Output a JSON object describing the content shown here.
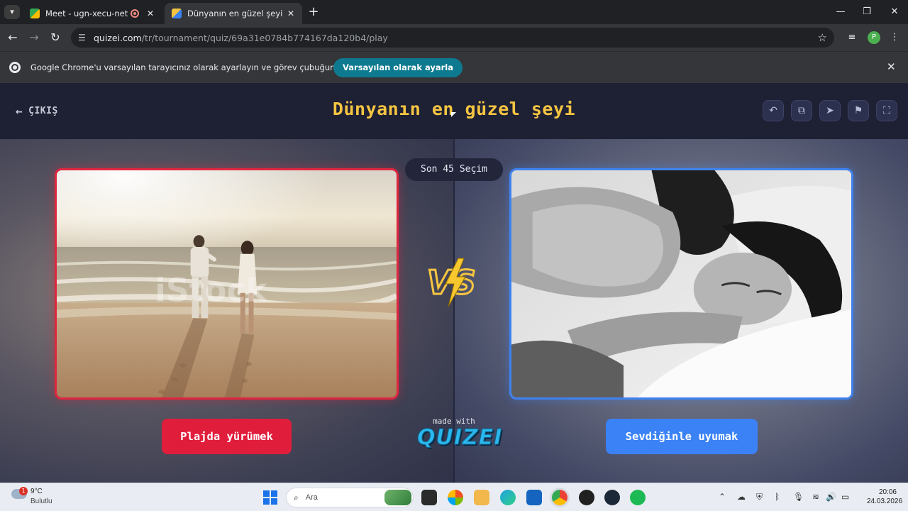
{
  "browser": {
    "tabs": [
      {
        "title": "Meet - ugn-xecu-net",
        "active": false
      },
      {
        "title": "Dünyanın en güzel şeyi - Tier Li",
        "active": true
      }
    ],
    "url_host": "quizei.com",
    "url_path": "/tr/tournament/quiz/69a31e0784b774167da120b4/play",
    "profile_initial": "P",
    "infobar": {
      "message": "Google Chrome'u varsayılan tarayıcınız olarak ayarlayın ve görev çubuğunuza sabitleyin",
      "button": "Varsayılan olarak ayarla"
    }
  },
  "page": {
    "exit_label": "ÇIKIŞ",
    "title": "Dünyanın en güzel şeyi",
    "round_badge": "Son 45 Seçim",
    "header_icons": [
      "undo-icon",
      "share-icon",
      "send-icon",
      "flag-icon",
      "fullscreen-icon"
    ],
    "left_choice": {
      "label": "Plajda yürümek",
      "accent": "#e11d3c"
    },
    "right_choice": {
      "label": "Sevdiğinle uyumak",
      "accent": "#3b82f6"
    },
    "vs_text": "VS",
    "made_with": "made with",
    "brand": "QUIZEI",
    "watermark": "iStock"
  },
  "taskbar": {
    "weather_badge": "1",
    "temperature": "9°C",
    "condition": "Bulutlu",
    "search_placeholder": "Ara",
    "time": "20:06",
    "date": "24.03.2026"
  }
}
